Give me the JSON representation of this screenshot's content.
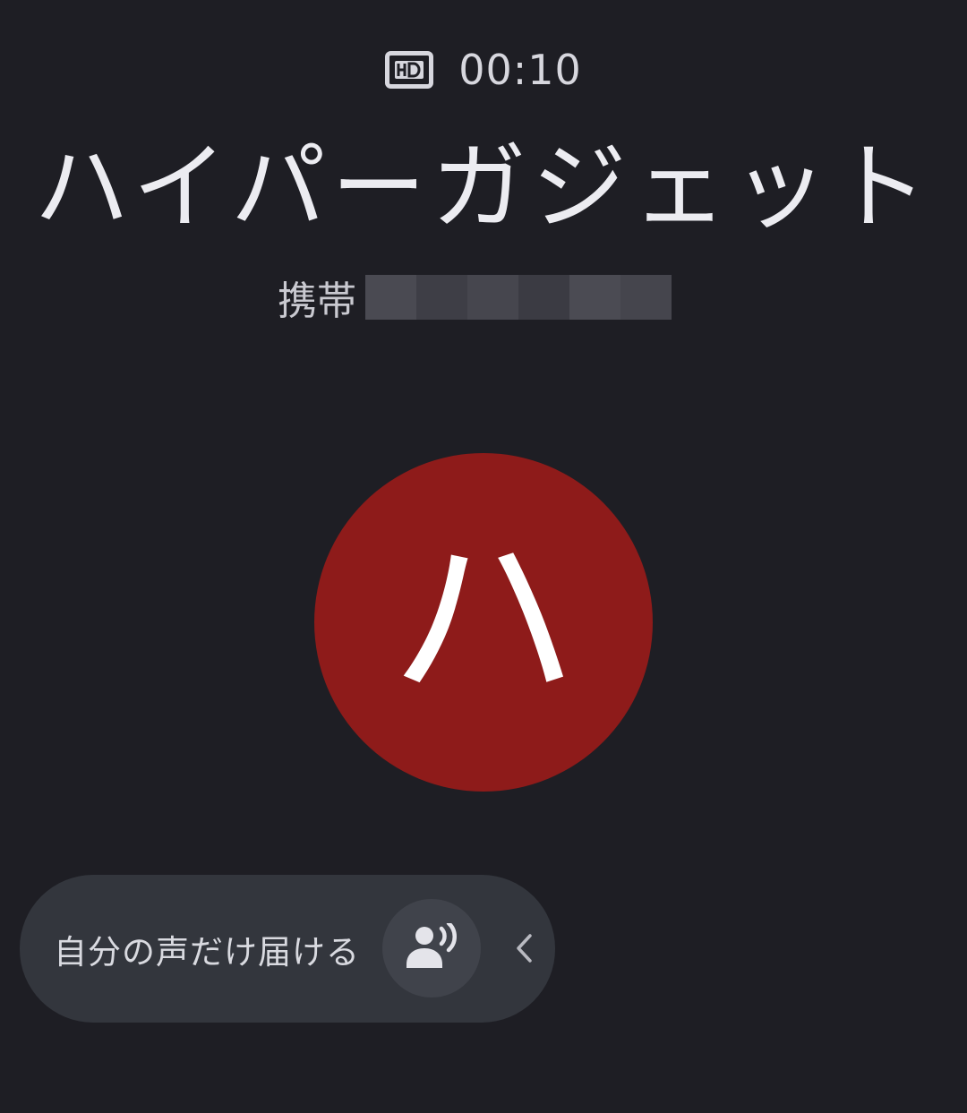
{
  "status": {
    "hd_icon": "hd-icon",
    "timer": "00:10"
  },
  "caller": {
    "name": "ハイパーガジェット",
    "number_label": "携帯",
    "avatar_letter": "ハ",
    "avatar_color": "#8e1b1a"
  },
  "feature": {
    "label": "自分の声だけ届ける",
    "icon": "voice-isolation-icon",
    "chevron_icon": "chevron-left-icon"
  },
  "colors": {
    "background": "#1e1e24",
    "pill": "#33363d",
    "pill_button": "#40434b",
    "redaction": [
      "#4a4a52",
      "#3e3e46",
      "#46464e",
      "#3b3b43",
      "#4b4b53",
      "#45454d"
    ]
  }
}
